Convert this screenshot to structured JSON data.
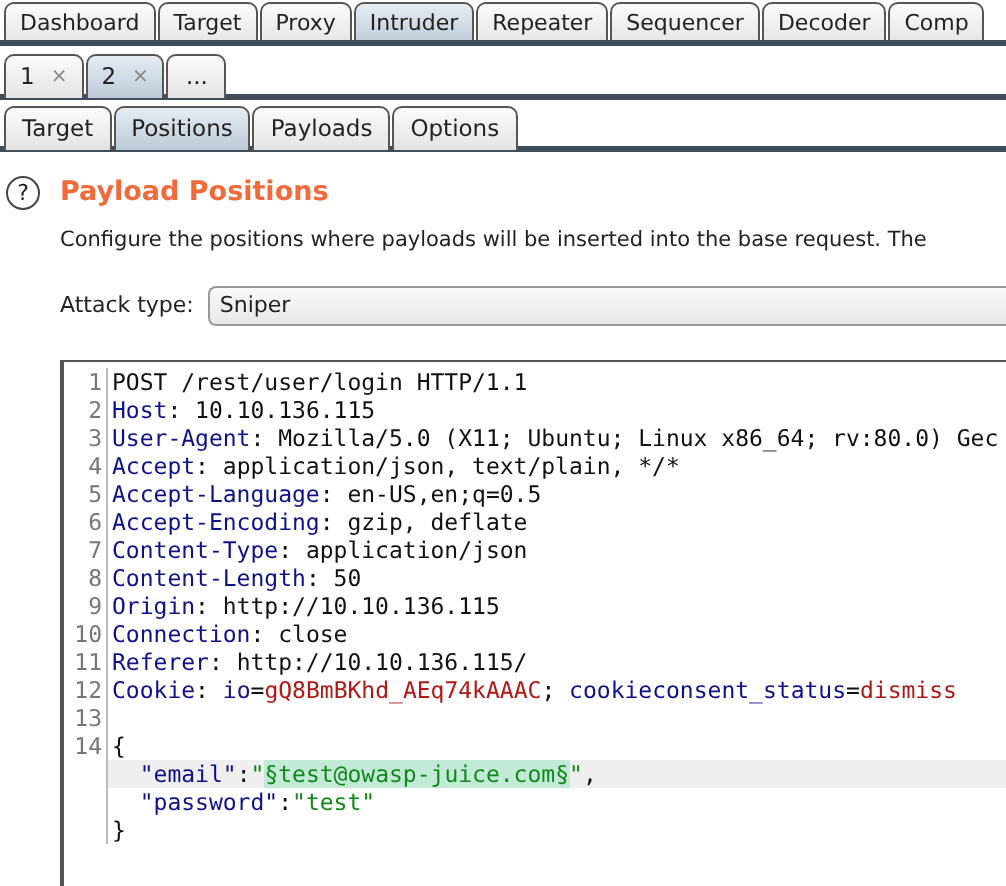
{
  "main_tabs": [
    {
      "label": "Dashboard",
      "selected": false
    },
    {
      "label": "Target",
      "selected": false
    },
    {
      "label": "Proxy",
      "selected": false
    },
    {
      "label": "Intruder",
      "selected": true
    },
    {
      "label": "Repeater",
      "selected": false
    },
    {
      "label": "Sequencer",
      "selected": false
    },
    {
      "label": "Decoder",
      "selected": false
    },
    {
      "label": "Comp",
      "selected": false
    }
  ],
  "attack_tabs": [
    {
      "label": "1",
      "close": "×",
      "selected": false
    },
    {
      "label": "2",
      "close": "×",
      "selected": true
    },
    {
      "label": "...",
      "selected": false
    }
  ],
  "sub_tabs": [
    {
      "label": "Target",
      "selected": false
    },
    {
      "label": "Positions",
      "selected": true
    },
    {
      "label": "Payloads",
      "selected": false
    },
    {
      "label": "Options",
      "selected": false
    }
  ],
  "section": {
    "help": "?",
    "title": "Payload Positions",
    "description": "Configure the positions where payloads will be inserted into the base request. The"
  },
  "attack_type": {
    "label": "Attack type:",
    "value": "Sniper"
  },
  "request_lines": [
    {
      "number": "1",
      "current": false,
      "tokens": [
        {
          "kind": "plain",
          "text": "POST /rest/user/login HTTP/1.1"
        }
      ]
    },
    {
      "number": "2",
      "current": false,
      "tokens": [
        {
          "kind": "name",
          "text": "Host"
        },
        {
          "kind": "plain",
          "text": ": 10.10.136.115"
        }
      ]
    },
    {
      "number": "3",
      "current": false,
      "tokens": [
        {
          "kind": "name",
          "text": "User-Agent"
        },
        {
          "kind": "plain",
          "text": ": Mozilla/5.0 (X11; Ubuntu; Linux x86_64; rv:80.0) Gec"
        }
      ]
    },
    {
      "number": "4",
      "current": false,
      "tokens": [
        {
          "kind": "name",
          "text": "Accept"
        },
        {
          "kind": "plain",
          "text": ": application/json, text/plain, */*"
        }
      ]
    },
    {
      "number": "5",
      "current": false,
      "tokens": [
        {
          "kind": "name",
          "text": "Accept-Language"
        },
        {
          "kind": "plain",
          "text": ": en-US,en;q=0.5"
        }
      ]
    },
    {
      "number": "6",
      "current": false,
      "tokens": [
        {
          "kind": "name",
          "text": "Accept-Encoding"
        },
        {
          "kind": "plain",
          "text": ": gzip, deflate"
        }
      ]
    },
    {
      "number": "7",
      "current": false,
      "tokens": [
        {
          "kind": "name",
          "text": "Content-Type"
        },
        {
          "kind": "plain",
          "text": ": application/json"
        }
      ]
    },
    {
      "number": "8",
      "current": false,
      "tokens": [
        {
          "kind": "name",
          "text": "Content-Length"
        },
        {
          "kind": "plain",
          "text": ": 50"
        }
      ]
    },
    {
      "number": "9",
      "current": false,
      "tokens": [
        {
          "kind": "name",
          "text": "Origin"
        },
        {
          "kind": "plain",
          "text": ": http://10.10.136.115"
        }
      ]
    },
    {
      "number": "10",
      "current": false,
      "tokens": [
        {
          "kind": "name",
          "text": "Connection"
        },
        {
          "kind": "plain",
          "text": ": close"
        }
      ]
    },
    {
      "number": "11",
      "current": false,
      "tokens": [
        {
          "kind": "name",
          "text": "Referer"
        },
        {
          "kind": "plain",
          "text": ": http://10.10.136.115/"
        }
      ]
    },
    {
      "number": "12",
      "current": false,
      "tokens": [
        {
          "kind": "name",
          "text": "Cookie"
        },
        {
          "kind": "plain",
          "text": ": "
        },
        {
          "kind": "name",
          "text": "io"
        },
        {
          "kind": "plain",
          "text": "="
        },
        {
          "kind": "value",
          "text": "gQ8BmBKhd_AEq74kAAAC"
        },
        {
          "kind": "plain",
          "text": "; "
        },
        {
          "kind": "name",
          "text": "cookieconsent_status"
        },
        {
          "kind": "plain",
          "text": "="
        },
        {
          "kind": "value",
          "text": "dismiss"
        }
      ]
    },
    {
      "number": "13",
      "current": false
    },
    {
      "number": "14",
      "current": false,
      "tokens": [
        {
          "kind": "plain",
          "text": "{"
        }
      ]
    },
    {
      "current": true,
      "tokens": [
        {
          "kind": "name",
          "text": "  \"email\""
        },
        {
          "kind": "plain",
          "text": ":"
        },
        {
          "kind": "string",
          "text": "\""
        },
        {
          "kind": "payload",
          "text": "§test@owasp-juice.com§"
        },
        {
          "kind": "string",
          "text": "\""
        },
        {
          "kind": "plain",
          "text": ","
        }
      ]
    },
    {
      "current": false,
      "tokens": [
        {
          "kind": "name",
          "text": "  \"password\""
        },
        {
          "kind": "plain",
          "text": ":"
        },
        {
          "kind": "string",
          "text": "\"test\""
        }
      ]
    },
    {
      "current": false,
      "tokens": [
        {
          "kind": "plain",
          "text": "}"
        }
      ]
    }
  ]
}
